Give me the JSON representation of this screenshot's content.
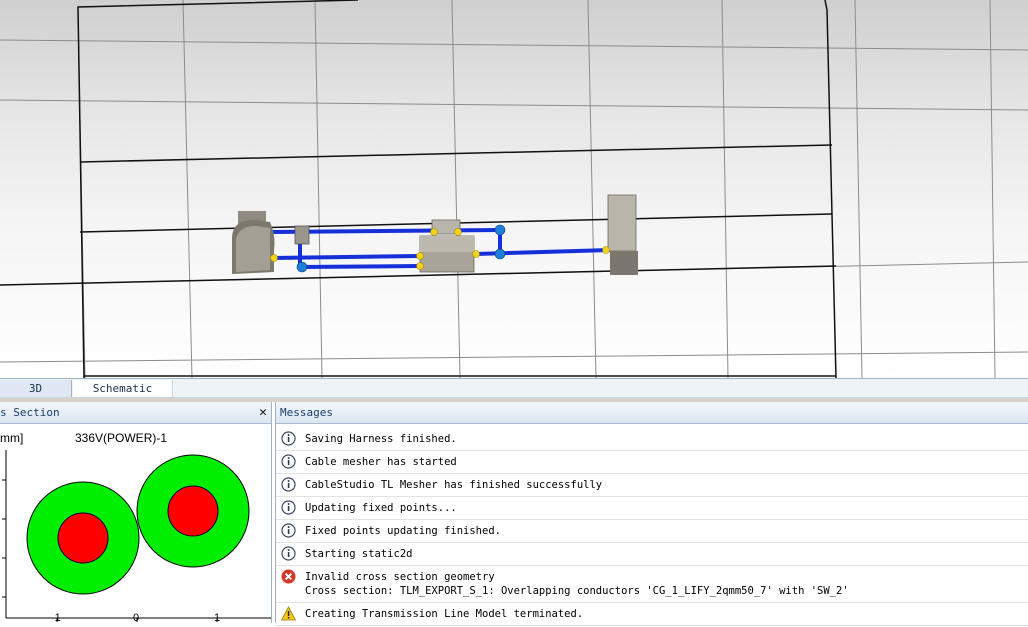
{
  "tabs": [
    {
      "label": "3D",
      "active": false
    },
    {
      "label": "Schematic",
      "active": true
    }
  ],
  "cross_section": {
    "title": "s Section",
    "unit_label": "mm]",
    "cable_name": "336V(POWER)-1",
    "x_ticks": [
      "-1",
      "0",
      "1"
    ],
    "insulation_color": "#00ee00",
    "conductor_color": "#ff0000"
  },
  "messages": {
    "title": "Messages",
    "items": [
      {
        "type": "info",
        "icon": "info-icon",
        "text": "Saving Harness finished."
      },
      {
        "type": "info",
        "icon": "info-icon",
        "text": "Cable mesher has started"
      },
      {
        "type": "info",
        "icon": "info-icon",
        "text": "CableStudio TL Mesher has finished successfully"
      },
      {
        "type": "info",
        "icon": "info-icon",
        "text": "Updating fixed points..."
      },
      {
        "type": "info",
        "icon": "info-icon",
        "text": "Fixed points updating finished."
      },
      {
        "type": "info",
        "icon": "info-icon",
        "text": "Starting static2d"
      },
      {
        "type": "error",
        "icon": "error-icon",
        "text": "Invalid cross section geometry",
        "detail": "Cross section: TLM_EXPORT_S_1: Overlapping conductors 'CG_1_LIFY_2qmm50_7' with 'SW_2'"
      },
      {
        "type": "warning",
        "icon": "warning-icon",
        "text": "Creating Transmission Line Model terminated."
      }
    ]
  },
  "colors": {
    "cable": "#1530d8",
    "node_yellow": "#f2d21b",
    "node_blue": "#1e7fd8",
    "component_gray": "#b9b5ab"
  }
}
